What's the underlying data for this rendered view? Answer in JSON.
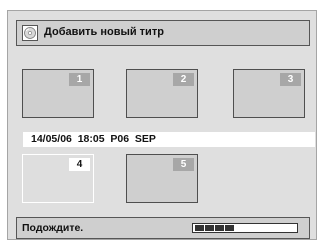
{
  "dialog": {
    "title": "Добавить новый титр",
    "icon": "disc-icon"
  },
  "titles": [
    {
      "number": "1",
      "selected": false
    },
    {
      "number": "2",
      "selected": false
    },
    {
      "number": "3",
      "selected": false
    },
    {
      "number": "4",
      "selected": true
    },
    {
      "number": "5",
      "selected": false
    }
  ],
  "info": {
    "text": "14/05/06  18:05  P06  SEP"
  },
  "status": {
    "text": "Подождите.",
    "progress_segments_filled": 4,
    "progress_segments_total": 10
  }
}
